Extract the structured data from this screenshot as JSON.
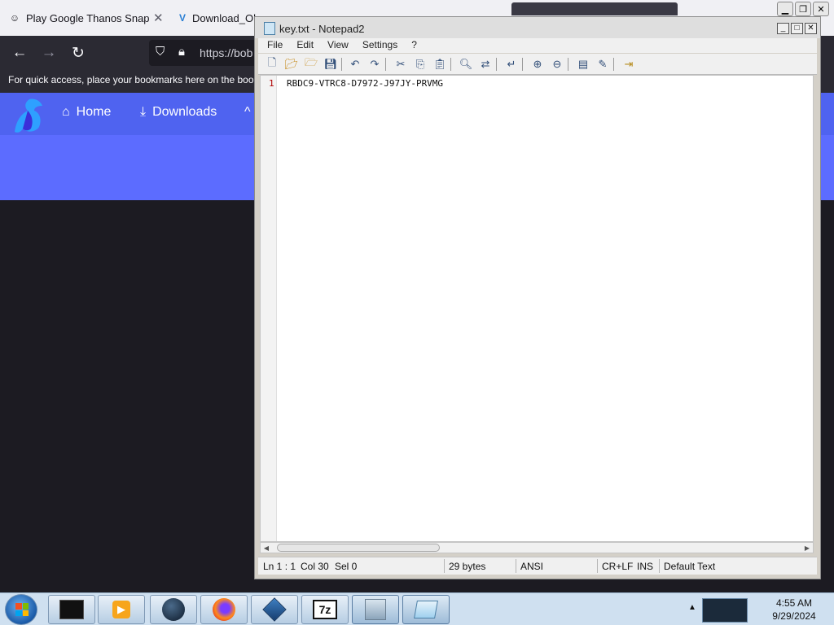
{
  "browser": {
    "tabs": [
      {
        "label": "Play Google Thanos Snap Ef"
      },
      {
        "label": "Download_Ol"
      }
    ],
    "url": "https://bob",
    "bookmarks_hint": "For quick access, place your bookmarks here on the book",
    "site_nav": {
      "home": "Home",
      "downloads": "Downloads",
      "more": "^"
    }
  },
  "notepad": {
    "title": "key.txt - Notepad2",
    "menu": [
      "File",
      "Edit",
      "View",
      "Settings",
      "?"
    ],
    "line_number": "1",
    "content": "RBDC9-VTRC8-D7972-J97JY-PRVMG",
    "status": {
      "position": "Ln 1 : 1",
      "col": "Col 30",
      "sel": "Sel 0",
      "bytes": "29 bytes",
      "encoding": "ANSI",
      "line_endings": "CR+LF",
      "mode": "INS",
      "scheme": "Default Text"
    }
  },
  "taskbar": {
    "time": "4:55 AM",
    "date": "9/29/2024",
    "task_seven_zip": "7z"
  },
  "colors": {
    "site_nav": "#4f63f0",
    "hero": "#5c6cff",
    "browser_dark": "#1c1b22",
    "taskbar": "#cfe0f0"
  }
}
